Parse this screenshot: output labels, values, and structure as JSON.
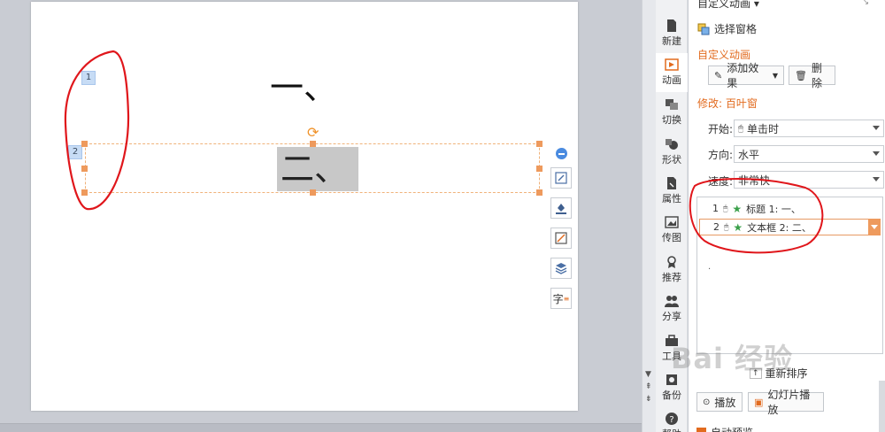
{
  "slide": {
    "tag1": "1",
    "tag2": "2",
    "title_text": "一、",
    "textbox_text": "二、"
  },
  "tabs": [
    {
      "label": "新建",
      "icon": "new-doc-icon"
    },
    {
      "label": "动画",
      "icon": "animation-icon"
    },
    {
      "label": "切换",
      "icon": "transition-icon"
    },
    {
      "label": "形状",
      "icon": "shape-icon"
    },
    {
      "label": "属性",
      "icon": "property-icon"
    },
    {
      "label": "传图",
      "icon": "image-icon"
    },
    {
      "label": "推荐",
      "icon": "ribbon-icon"
    },
    {
      "label": "分享",
      "icon": "people-icon"
    },
    {
      "label": "工具",
      "icon": "toolbox-icon"
    },
    {
      "label": "备份",
      "icon": "backup-icon"
    },
    {
      "label": "帮助",
      "icon": "help-icon"
    }
  ],
  "panel": {
    "title": "自定义动画 ▾",
    "select_pane": "选择窗格",
    "custom_anim_header": "自定义动画",
    "add_effect": "添加效果",
    "delete": "删除",
    "modify_header": "修改: 百叶窗",
    "start_label": "开始:",
    "start_value": "单击时",
    "direction_label": "方向:",
    "direction_value": "水平",
    "speed_label": "速度:",
    "speed_value": "非常快",
    "items": [
      {
        "num": "1",
        "text": "标题 1: 一、"
      },
      {
        "num": "2",
        "text": "文本框 2: 二、"
      }
    ],
    "reorder": "重新排序",
    "play": "播放",
    "slideshow": "幻灯片播放",
    "autopreview": "自动预览"
  },
  "watermark": "Bai 经验",
  "colors": {
    "accent": "#e26b1f",
    "selection": "#ee9a5d",
    "annotation": "#e0161b"
  }
}
